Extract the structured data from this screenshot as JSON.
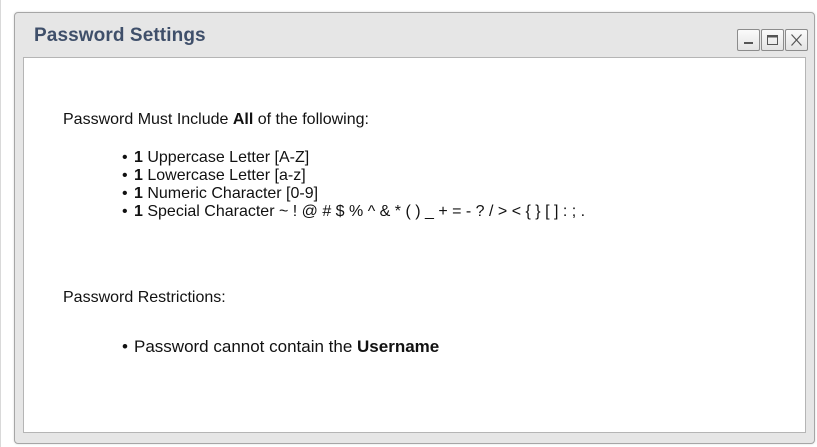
{
  "window": {
    "title": "Password Settings",
    "controls": {
      "minimize_icon": "minimize-icon",
      "maximize_icon": "maximize-icon",
      "close_icon": "close-icon"
    }
  },
  "requirements": {
    "heading_prefix": "Password Must Include ",
    "heading_emphasis": "All",
    "heading_suffix": " of the following:",
    "bullet_char": "•",
    "items": [
      {
        "count": "1",
        "text": " Uppercase Letter [A-Z]"
      },
      {
        "count": "1",
        "text": " Lowercase Letter [a-z]"
      },
      {
        "count": "1",
        "text": " Numeric Character [0-9]"
      },
      {
        "count": "1",
        "text": " Special Character ~ ! @ # $ % ^ & * ( ) _ + = - ? / > < { } [ ] : ; ."
      }
    ]
  },
  "restrictions": {
    "heading": "Password Restrictions:",
    "items": [
      {
        "prefix": "Password cannot contain the ",
        "emphasis": "Username"
      }
    ]
  },
  "colors": {
    "title_text": "#3f4f6a",
    "dialog_background": "#e6e6e6",
    "content_background": "#ffffff",
    "border": "#a6a6a6"
  }
}
